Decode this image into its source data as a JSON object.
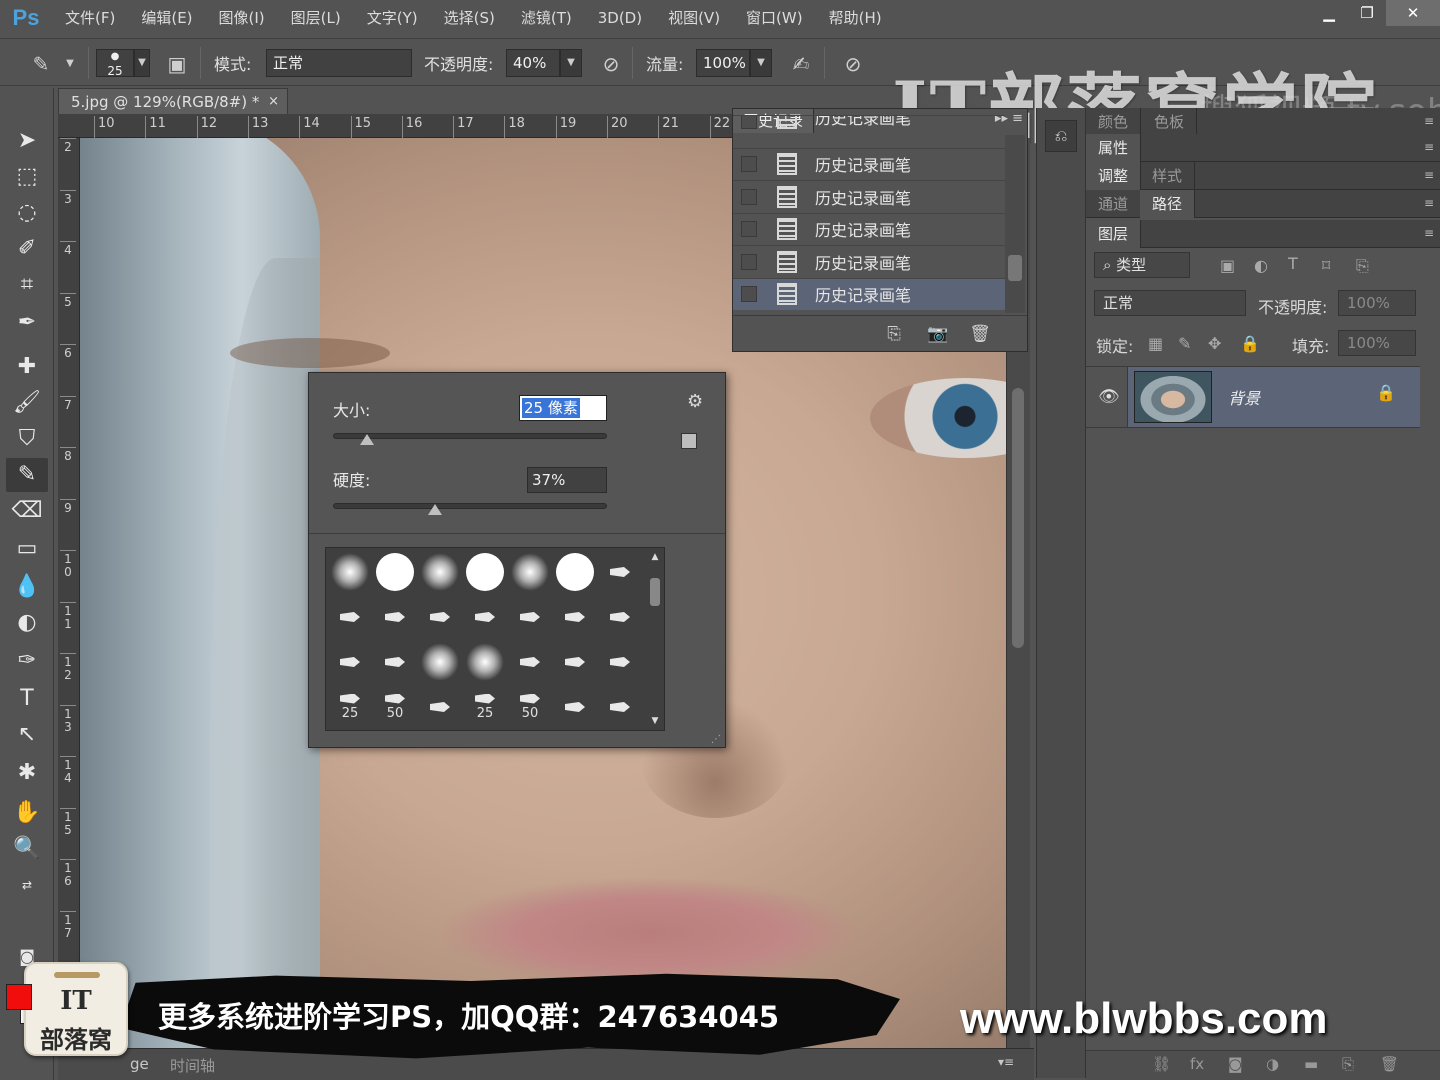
{
  "app": {
    "logo": "Ps"
  },
  "menu": [
    "文件(F)",
    "编辑(E)",
    "图像(I)",
    "图层(L)",
    "文字(Y)",
    "选择(S)",
    "滤镜(T)",
    "3D(D)",
    "视图(V)",
    "窗口(W)",
    "帮助(H)"
  ],
  "window_controls": {
    "minimize": "▁",
    "restore": "❐",
    "close": "✕"
  },
  "options": {
    "brush_size": "25",
    "mode_label": "模式:",
    "mode_value": "正常",
    "opacity_label": "不透明度:",
    "opacity_value": "40%",
    "flow_label": "流量:",
    "flow_value": "100%"
  },
  "watermark": {
    "title": "IT部落窝学院",
    "sub": "搜狐视频 tv.sohu.com"
  },
  "document": {
    "tab_title": "5.jpg @ 129%(RGB/8#) *",
    "tab_close": "×",
    "ruler_top": [
      "10",
      "11",
      "12",
      "13",
      "14",
      "15",
      "16",
      "17",
      "18",
      "19",
      "20",
      "21",
      "22"
    ],
    "ruler_left": [
      "2",
      "3",
      "4",
      "5",
      "6",
      "7",
      "8",
      "9",
      "1\n0",
      "1\n1",
      "1\n2",
      "1\n3",
      "1\n4",
      "1\n5",
      "1\n6",
      "1\n7"
    ]
  },
  "history": {
    "title": "历史记录",
    "items": [
      "历史记录画笔",
      "历史记录画笔",
      "历史记录画笔",
      "历史记录画笔",
      "历史记录画笔",
      "历史记录画笔"
    ],
    "selected_index": 5
  },
  "brush_popup": {
    "size_label": "大小:",
    "size_value": "25 像素",
    "size_fraction": 0.12,
    "hardness_label": "硬度:",
    "hardness_value": "37%",
    "hardness_fraction": 0.37,
    "presets_row4_numbers": [
      "25",
      "50",
      "",
      "25",
      "50",
      "",
      ""
    ]
  },
  "right_panel": {
    "tab_color": "颜色",
    "tab_swatches": "色板",
    "tab_properties": "属性",
    "tab_adjustments": "调整",
    "tab_styles": "样式",
    "tab_channels": "通道",
    "tab_paths": "路径",
    "tab_layers": "图层",
    "filter_kind": "类型",
    "blend_mode": "正常",
    "opacity_label": "不透明度:",
    "opacity_value": "100%",
    "lock_label": "锁定:",
    "fill_label": "填充:",
    "fill_value": "100%",
    "layer_name": "背景"
  },
  "timeline": {
    "left_label": "ge",
    "tab": "时间轴"
  },
  "promo": {
    "text": "更多系统进阶学习PS，加QQ群：247634045",
    "url": "www.blwbbs.com",
    "logo_line1": "IT",
    "logo_line2": "部落窝"
  },
  "colors": {
    "foreground": "#f20d0d",
    "background": "#ffffff",
    "selection": "#5c6478"
  }
}
